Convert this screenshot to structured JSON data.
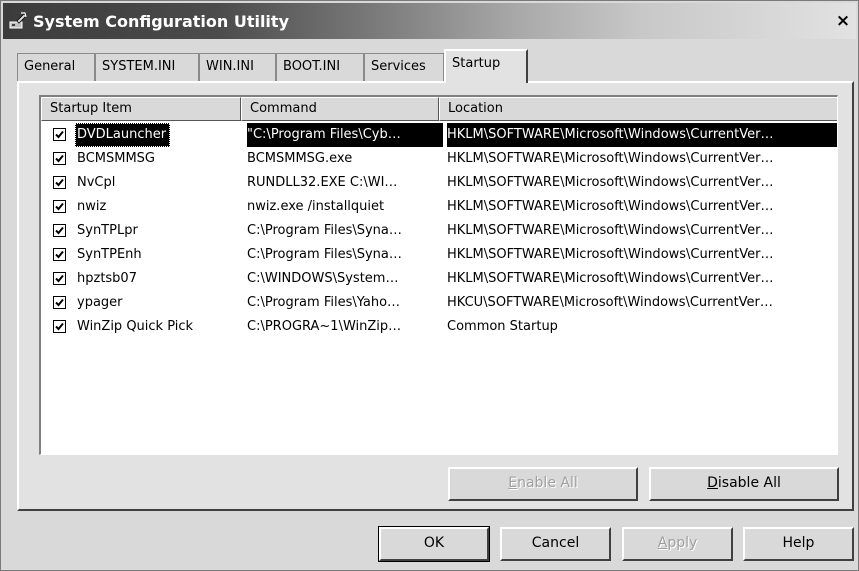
{
  "window": {
    "title": "System Configuration Utility",
    "close_label": "×"
  },
  "tabs": [
    {
      "label": "General"
    },
    {
      "label": "SYSTEM.INI"
    },
    {
      "label": "WIN.INI"
    },
    {
      "label": "BOOT.INI"
    },
    {
      "label": "Services"
    },
    {
      "label": "Startup",
      "active": true
    }
  ],
  "list": {
    "columns": [
      "Startup Item",
      "Command",
      "Location"
    ],
    "rows": [
      {
        "name": "DVDLauncher",
        "command": "\"C:\\Program Files\\Cyb…",
        "location": "HKLM\\SOFTWARE\\Microsoft\\Windows\\CurrentVer…",
        "checked": true,
        "selected": true
      },
      {
        "name": "BCMSMMSG",
        "command": "BCMSMMSG.exe",
        "location": "HKLM\\SOFTWARE\\Microsoft\\Windows\\CurrentVer…",
        "checked": true
      },
      {
        "name": "NvCpl",
        "command": "RUNDLL32.EXE C:\\WI…",
        "location": "HKLM\\SOFTWARE\\Microsoft\\Windows\\CurrentVer…",
        "checked": true
      },
      {
        "name": "nwiz",
        "command": "nwiz.exe /installquiet",
        "location": "HKLM\\SOFTWARE\\Microsoft\\Windows\\CurrentVer…",
        "checked": true
      },
      {
        "name": "SynTPLpr",
        "command": "C:\\Program Files\\Syna…",
        "location": "HKLM\\SOFTWARE\\Microsoft\\Windows\\CurrentVer…",
        "checked": true
      },
      {
        "name": "SynTPEnh",
        "command": "C:\\Program Files\\Syna…",
        "location": "HKLM\\SOFTWARE\\Microsoft\\Windows\\CurrentVer…",
        "checked": true
      },
      {
        "name": "hpztsb07",
        "command": "C:\\WINDOWS\\System…",
        "location": "HKLM\\SOFTWARE\\Microsoft\\Windows\\CurrentVer…",
        "checked": true
      },
      {
        "name": "ypager",
        "command": "C:\\Program Files\\Yaho…",
        "location": "HKCU\\SOFTWARE\\Microsoft\\Windows\\CurrentVer…",
        "checked": true
      },
      {
        "name": "WinZip Quick Pick",
        "command": "C:\\PROGRA~1\\WinZip…",
        "location": "Common Startup",
        "checked": true
      }
    ]
  },
  "panel_buttons": {
    "enable_all": {
      "label": "Enable All",
      "mnemonic": "E",
      "rest": "nable All",
      "disabled": true
    },
    "disable_all": {
      "label": "Disable All",
      "mnemonic": "D",
      "rest": "isable All",
      "disabled": false
    }
  },
  "dialog_buttons": {
    "ok": {
      "label": "OK"
    },
    "cancel": {
      "label": "Cancel"
    },
    "apply": {
      "label": "Apply",
      "mnemonic": "A",
      "rest": "pply",
      "disabled": true
    },
    "help": {
      "label": "Help"
    }
  },
  "icons": {
    "title": "system-config-icon",
    "checkbox": "checkmark-icon"
  }
}
